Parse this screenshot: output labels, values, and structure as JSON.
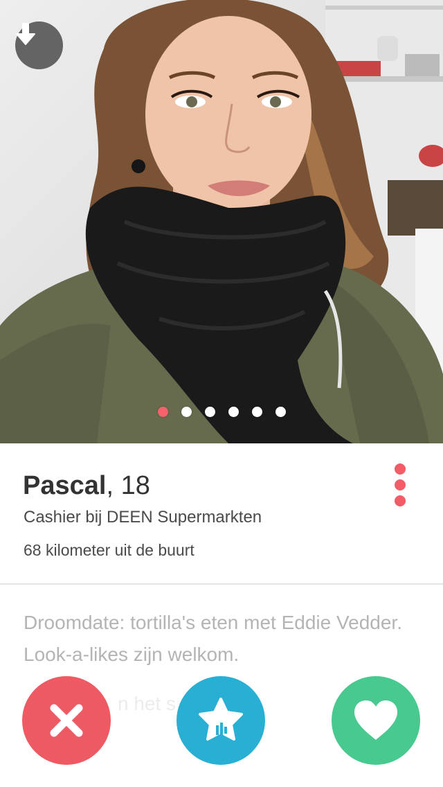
{
  "profile": {
    "name": "Pascal",
    "age_text": ", 18",
    "job": "Cashier bij DEEN Supermarkten",
    "distance": "68 kilometer uit de buurt",
    "bio": "Droomdate: tortilla's eten met Eddie Vedder. Look-a-likes zijn welkom.",
    "bio_faded": "n het s"
  },
  "photo_pager": {
    "total": 6,
    "active_index": 0
  },
  "icons": {
    "download": "arrow-down-icon",
    "more": "vertical-dots-icon",
    "nope": "x-icon",
    "super_like": "star-icon",
    "like": "heart-icon"
  },
  "colors": {
    "nope": "#ee5a63",
    "super_like": "#29afd4",
    "like": "#48c98f",
    "accent": "#f5626b"
  }
}
